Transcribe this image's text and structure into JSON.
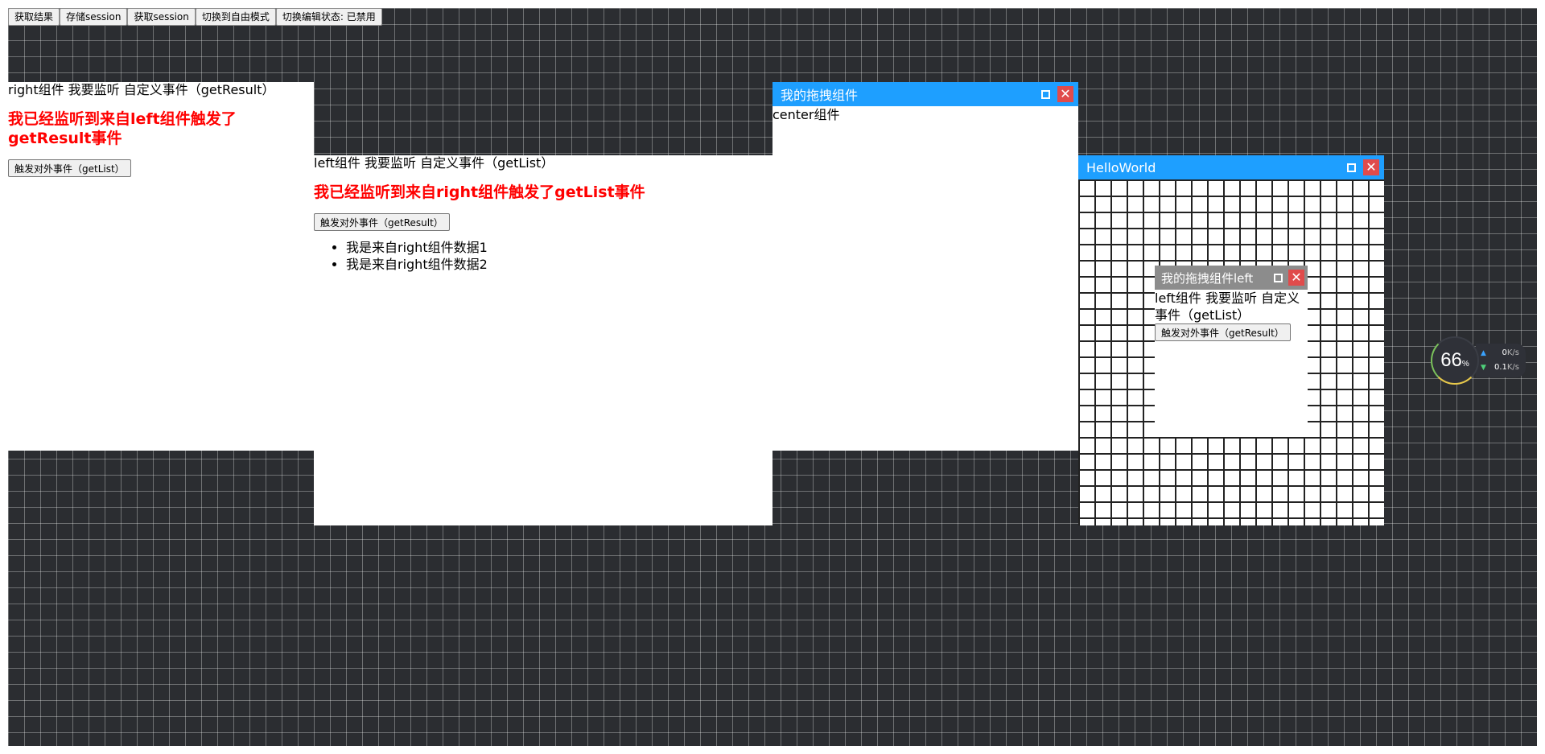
{
  "toolbar": {
    "get_result": "获取结果",
    "save_session": "存储session",
    "get_session": "获取session",
    "switch_free": "切换到自由模式",
    "toggle_edit": "切换编辑状态: 已禁用"
  },
  "right_panel": {
    "heading": "right组件 我要监听 自定义事件（getResult）",
    "alert": "我已经监听到来自left组件触发了getResult事件",
    "button": "触发对外事件（getList）"
  },
  "left_panel": {
    "heading": "left组件 我要监听 自定义事件（getList）",
    "alert": "我已经监听到来自right组件触发了getList事件",
    "button": "触发对外事件（getResult）",
    "items": [
      "我是来自right组件数据1",
      "我是来自right组件数据2"
    ]
  },
  "center_window": {
    "title": "我的拖拽组件",
    "body": "center组件"
  },
  "hello_window": {
    "title": "HelloWorld"
  },
  "nested_window": {
    "title": "我的拖拽组件left",
    "heading": "left组件 我要监听 自定义事件（getList）",
    "button": "触发对外事件（getResult）"
  },
  "net_widget": {
    "percent": "66",
    "percent_sign": "%",
    "upload": "0",
    "download": "0.1",
    "unit": "K/s"
  },
  "colors": {
    "canvas_bg": "#2b2d31",
    "window_header": "#1e9fff",
    "nested_header": "#8c8c8c",
    "close_button": "#e04b4b",
    "alert_text": "#ff0000"
  }
}
